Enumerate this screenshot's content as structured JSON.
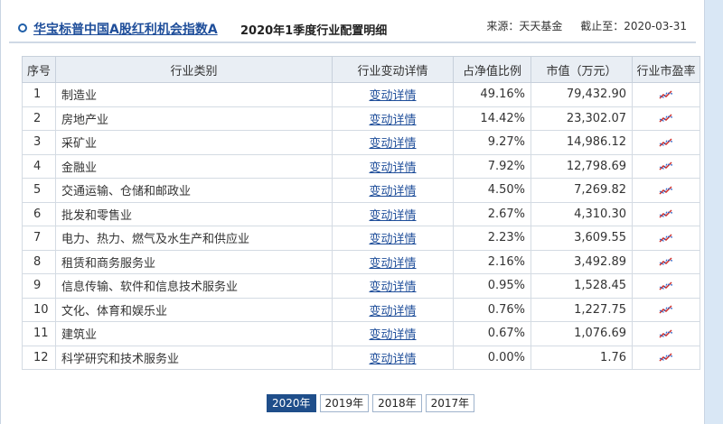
{
  "header": {
    "fund_name": "华宝标普中国A股红利机会指数A",
    "report_title": "2020年1季度行业配置明细",
    "source_label": "来源：",
    "source_value": "天天基金",
    "cutoff_label": "截止至：",
    "cutoff_value": "2020-03-31"
  },
  "table": {
    "columns": [
      "序号",
      "行业类别",
      "行业变动详情",
      "占净值比例",
      "市值（万元）",
      "行业市盈率"
    ],
    "link_text": "变动详情",
    "rows": [
      {
        "no": "1",
        "industry": "制造业",
        "ratio": "49.16%",
        "value": "79,432.90"
      },
      {
        "no": "2",
        "industry": "房地产业",
        "ratio": "14.42%",
        "value": "23,302.07"
      },
      {
        "no": "3",
        "industry": "采矿业",
        "ratio": "9.27%",
        "value": "14,986.12"
      },
      {
        "no": "4",
        "industry": "金融业",
        "ratio": "7.92%",
        "value": "12,798.69"
      },
      {
        "no": "5",
        "industry": "交通运输、仓储和邮政业",
        "ratio": "4.50%",
        "value": "7,269.82"
      },
      {
        "no": "6",
        "industry": "批发和零售业",
        "ratio": "2.67%",
        "value": "4,310.30"
      },
      {
        "no": "7",
        "industry": "电力、热力、燃气及水生产和供应业",
        "ratio": "2.23%",
        "value": "3,609.55"
      },
      {
        "no": "8",
        "industry": "租赁和商务服务业",
        "ratio": "2.16%",
        "value": "3,492.89"
      },
      {
        "no": "9",
        "industry": "信息传输、软件和信息技术服务业",
        "ratio": "0.95%",
        "value": "1,528.45"
      },
      {
        "no": "10",
        "industry": "文化、体育和娱乐业",
        "ratio": "0.76%",
        "value": "1,227.75"
      },
      {
        "no": "11",
        "industry": "建筑业",
        "ratio": "0.67%",
        "value": "1,076.69"
      },
      {
        "no": "12",
        "industry": "科学研究和技术服务业",
        "ratio": "0.00%",
        "value": "1.76"
      }
    ],
    "pe_icon": "trend-chart-icon"
  },
  "years": {
    "options": [
      "2020年",
      "2019年",
      "2018年",
      "2017年"
    ],
    "selected": "2020年"
  },
  "colors": {
    "link": "#1f4e9a",
    "header_bg": "#e9eef4",
    "active_year": "#1f4e8a",
    "gutter": "#d9e7f5"
  }
}
